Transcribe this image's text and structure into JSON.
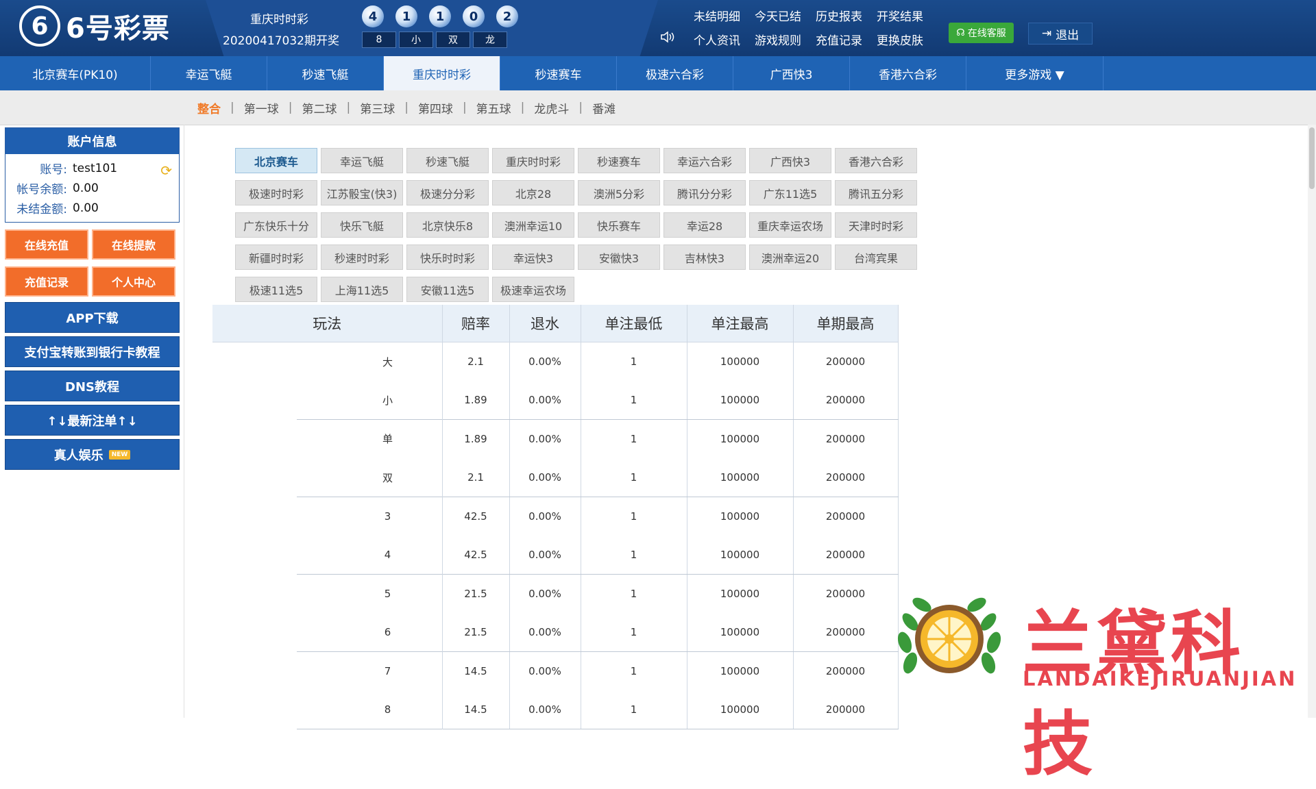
{
  "header": {
    "logo_digit": "6",
    "logo_text": "6号彩票",
    "lottery_name": "重庆时时彩",
    "lottery_period": "20200417032期开奖",
    "balls": [
      "4",
      "1",
      "1",
      "0",
      "2"
    ],
    "result_boxes": [
      "8",
      "小",
      "双",
      "龙"
    ],
    "links": [
      "未结明细",
      "今天已结",
      "历史报表",
      "开奖结果",
      "个人资讯",
      "游戏规则",
      "充值记录",
      "更换皮肤"
    ],
    "kefu": "在线客服",
    "logout": "退出"
  },
  "nav": {
    "items": [
      "北京赛车(PK10)",
      "幸运飞艇",
      "秒速飞艇",
      "重庆时时彩",
      "秒速赛车",
      "极速六合彩",
      "广西快3",
      "香港六合彩",
      "更多游戏 ▼"
    ],
    "active_index": 3
  },
  "subnav": {
    "items": [
      "整合",
      "第一球",
      "第二球",
      "第三球",
      "第四球",
      "第五球",
      "龙虎斗",
      "番滩"
    ],
    "active_index": 0
  },
  "account": {
    "title": "账户信息",
    "rows": [
      {
        "label": "账号:",
        "value": "test101"
      },
      {
        "label": "帐号余额:",
        "value": "0.00"
      },
      {
        "label": "未结金额:",
        "value": "0.00"
      }
    ]
  },
  "sidebar": {
    "orange_buttons": [
      "在线充值",
      "在线提款",
      "充值记录",
      "个人中心"
    ],
    "blue_buttons": [
      "APP下载",
      "支付宝转账到银行卡教程",
      "DNS教程",
      "↑↓最新注单↑↓",
      "真人娱乐"
    ],
    "new_tag": "NEW"
  },
  "games": [
    "北京赛车",
    "幸运飞艇",
    "秒速飞艇",
    "重庆时时彩",
    "秒速赛车",
    "幸运六合彩",
    "广西快3",
    "香港六合彩",
    "极速时时彩",
    "江苏骰宝(快3)",
    "极速分分彩",
    "北京28",
    "澳洲5分彩",
    "腾讯分分彩",
    "广东11选5",
    "腾讯五分彩",
    "广东快乐十分",
    "快乐飞艇",
    "北京快乐8",
    "澳洲幸运10",
    "快乐赛车",
    "幸运28",
    "重庆幸运农场",
    "天津时时彩",
    "新疆时时彩",
    "秒速时时彩",
    "快乐时时彩",
    "幸运快3",
    "安徽快3",
    "吉林快3",
    "澳洲幸运20",
    "台湾宾果",
    "极速11选5",
    "上海11选5",
    "安徽11选5",
    "极速幸运农场"
  ],
  "games_active_index": 0,
  "table": {
    "headers": [
      "玩法",
      "赔率",
      "退水",
      "单注最低",
      "单注最高",
      "单期最高"
    ],
    "rows": [
      [
        "大",
        "2.1",
        "0.00%",
        "1",
        "100000",
        "200000"
      ],
      [
        "小",
        "1.89",
        "0.00%",
        "1",
        "100000",
        "200000"
      ],
      [
        "单",
        "1.89",
        "0.00%",
        "1",
        "100000",
        "200000"
      ],
      [
        "双",
        "2.1",
        "0.00%",
        "1",
        "100000",
        "200000"
      ],
      [
        "3",
        "42.5",
        "0.00%",
        "1",
        "100000",
        "200000"
      ],
      [
        "4",
        "42.5",
        "0.00%",
        "1",
        "100000",
        "200000"
      ],
      [
        "5",
        "21.5",
        "0.00%",
        "1",
        "100000",
        "200000"
      ],
      [
        "6",
        "21.5",
        "0.00%",
        "1",
        "100000",
        "200000"
      ],
      [
        "7",
        "14.5",
        "0.00%",
        "1",
        "100000",
        "200000"
      ],
      [
        "8",
        "14.5",
        "0.00%",
        "1",
        "100000",
        "200000"
      ]
    ]
  },
  "watermark": {
    "title": "兰黛科技",
    "subtitle": "LANDAIKEJIRUANJIAN"
  },
  "colors": {
    "header_bg": "#123a73",
    "nav_bg": "#1f63b4",
    "orange": "#f26d2a",
    "accent_active": "#f07a28",
    "watermark": "#e8454f"
  }
}
